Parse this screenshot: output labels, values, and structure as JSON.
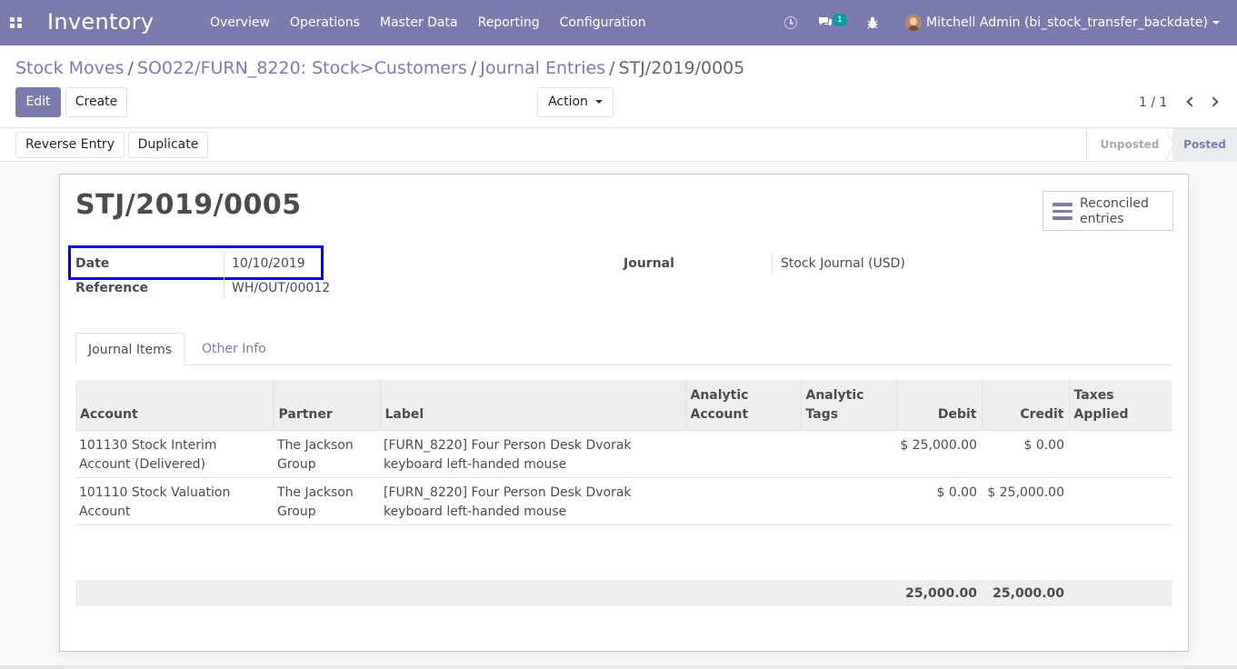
{
  "app": {
    "title": "Inventory",
    "menu": [
      "Overview",
      "Operations",
      "Master Data",
      "Reporting",
      "Configuration"
    ],
    "chat_badge": "1",
    "user": "Mitchell Admin (bi_stock_transfer_backdate)",
    "accent_color": "#7c7bad"
  },
  "breadcrumb": {
    "items": [
      "Stock Moves",
      "SO022/FURN_8220: Stock>Customers",
      "Journal Entries"
    ],
    "current": "STJ/2019/0005",
    "separator": "/"
  },
  "toolbar": {
    "edit_label": "Edit",
    "create_label": "Create",
    "action_label": "Action",
    "pager": "1 / 1"
  },
  "statusbar": {
    "reverse_label": "Reverse Entry",
    "duplicate_label": "Duplicate",
    "stages": [
      "Unposted",
      "Posted"
    ],
    "current_stage": "Posted"
  },
  "form": {
    "title": "STJ/2019/0005",
    "smart_button": {
      "line1": "Reconciled",
      "line2": "entries"
    },
    "date_label": "Date",
    "date_value": "10/10/2019",
    "reference_label": "Reference",
    "reference_value": "WH/OUT/00012",
    "journal_label": "Journal",
    "journal_value": "Stock Journal (USD)",
    "highlight_color": "#0000ff"
  },
  "tabs": [
    "Journal Items",
    "Other Info"
  ],
  "journal_items": {
    "headers": [
      {
        "l1": "",
        "l2": "Account"
      },
      {
        "l1": "",
        "l2": "Partner"
      },
      {
        "l1": "",
        "l2": "Label"
      },
      {
        "l1": "Analytic",
        "l2": "Account"
      },
      {
        "l1": "Analytic",
        "l2": "Tags"
      },
      {
        "l1": "",
        "l2": "Debit"
      },
      {
        "l1": "",
        "l2": "Credit"
      },
      {
        "l1": "Taxes",
        "l2": "Applied"
      }
    ],
    "rows": [
      {
        "account_1": "101130 Stock Interim",
        "account_2": "Account (Delivered)",
        "partner_1": "The Jackson",
        "partner_2": "Group",
        "label_1": "[FURN_8220] Four Person Desk Dvorak",
        "label_2": "keyboard left-handed mouse",
        "analytic_account": "",
        "analytic_tags": "",
        "debit": "$ 25,000.00",
        "credit": "$ 0.00",
        "taxes": ""
      },
      {
        "account_1": "101110 Stock Valuation",
        "account_2": "Account",
        "partner_1": "The Jackson",
        "partner_2": "Group",
        "label_1": "[FURN_8220] Four Person Desk Dvorak",
        "label_2": "keyboard left-handed mouse",
        "analytic_account": "",
        "analytic_tags": "",
        "debit": "$ 0.00",
        "credit": "$ 25,000.00",
        "taxes": ""
      }
    ],
    "total_debit": "25,000.00",
    "total_credit": "25,000.00"
  }
}
